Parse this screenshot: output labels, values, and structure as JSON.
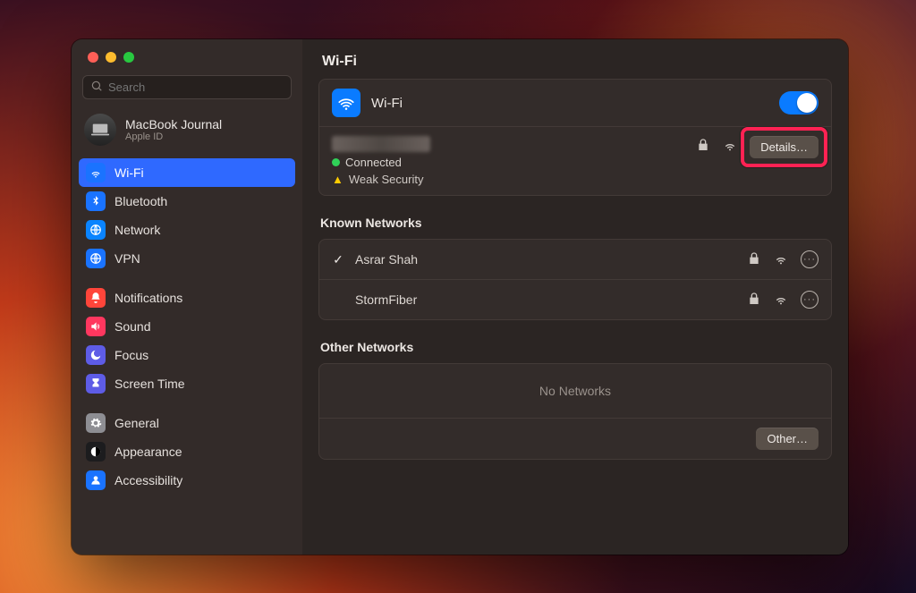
{
  "window_title": "Wi-Fi",
  "search_placeholder": "Search",
  "account": {
    "name": "MacBook Journal",
    "sub": "Apple ID"
  },
  "sidebar_groups": [
    {
      "items": [
        {
          "id": "wifi",
          "label": "Wi-Fi",
          "active": true,
          "color": "blue",
          "icon": "wifi"
        },
        {
          "id": "bluetooth",
          "label": "Bluetooth",
          "color": "blue",
          "icon": "bluetooth"
        },
        {
          "id": "network",
          "label": "Network",
          "color": "globe",
          "icon": "globe"
        },
        {
          "id": "vpn",
          "label": "VPN",
          "color": "blue",
          "icon": "globe"
        }
      ]
    },
    {
      "items": [
        {
          "id": "notifications",
          "label": "Notifications",
          "color": "red",
          "icon": "bell"
        },
        {
          "id": "sound",
          "label": "Sound",
          "color": "pink",
          "icon": "speaker"
        },
        {
          "id": "focus",
          "label": "Focus",
          "color": "purple",
          "icon": "moon"
        },
        {
          "id": "screentime",
          "label": "Screen Time",
          "color": "purple",
          "icon": "hourglass"
        }
      ]
    },
    {
      "items": [
        {
          "id": "general",
          "label": "General",
          "color": "grey",
          "icon": "gear"
        },
        {
          "id": "appearance",
          "label": "Appearance",
          "color": "black",
          "icon": "appearance"
        },
        {
          "id": "accessibility",
          "label": "Accessibility",
          "color": "blue",
          "icon": "person"
        }
      ]
    }
  ],
  "wifi_panel": {
    "label": "Wi-Fi",
    "enabled": true,
    "connected_status": "Connected",
    "security_warning": "Weak Security",
    "details_button": "Details…"
  },
  "known_networks": {
    "title": "Known Networks",
    "items": [
      {
        "name": "Asrar Shah",
        "connected": true,
        "locked": true
      },
      {
        "name": "StormFiber",
        "connected": false,
        "locked": true
      }
    ]
  },
  "other_networks": {
    "title": "Other Networks",
    "empty_text": "No Networks",
    "other_button": "Other…"
  }
}
